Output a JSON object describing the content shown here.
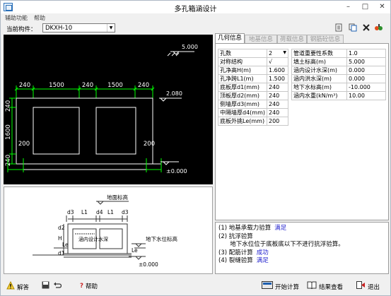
{
  "window": {
    "title": "多孔箱涵设计"
  },
  "menu": [
    "辅助功能",
    "帮助"
  ],
  "component": {
    "label": "当前构件：",
    "value": "DKXH-10"
  },
  "toolbar_icons": [
    "new-file-icon",
    "copy-icon",
    "delete-icon",
    "settings-icon"
  ],
  "tabs": [
    {
      "label": "几何信息",
      "active": true
    },
    {
      "label": "地基信息",
      "active": false
    },
    {
      "label": "荷载信息",
      "active": false
    },
    {
      "label": "钢筋砼信息",
      "active": false
    }
  ],
  "geometry_params": [
    {
      "name": "孔数",
      "value": "2",
      "dropdown": true
    },
    {
      "name": "对称结构",
      "value": "√"
    },
    {
      "name": "孔净高H(m)",
      "value": "1.600"
    },
    {
      "name": "孔净跨L1(m)",
      "value": "1.500"
    },
    {
      "name": "底板厚d1(mm)",
      "value": "240"
    },
    {
      "name": "顶板厚d2(mm)",
      "value": "240"
    },
    {
      "name": "侧墙厚d3(mm)",
      "value": "240"
    },
    {
      "name": "中隔墙厚d4(mm)",
      "value": "240"
    },
    {
      "name": "底板外挑Le(mm)",
      "value": "200"
    }
  ],
  "other_params": [
    {
      "name": "管道重要性系数",
      "value": "1.0"
    },
    {
      "name": "填土标高(m)",
      "value": "5.000"
    },
    {
      "name": "涵内设计水深(m)",
      "value": "0.000"
    },
    {
      "name": "涵内洪水深(m)",
      "value": "0.000"
    },
    {
      "name": "地下水标高(m)",
      "value": "-10.000"
    },
    {
      "name": "涵内水重(kN/m³)",
      "value": "10.00"
    }
  ],
  "drawing": {
    "fill_elev": "5.000",
    "top_elev": "2.080",
    "base_elev": "±0.000",
    "top_dims": [
      "240",
      "1500",
      "240",
      "1500",
      "240"
    ],
    "height_dims": [
      "240",
      "1600",
      "240"
    ],
    "bottom_dims": [
      "200",
      "200"
    ]
  },
  "schematic": {
    "ground_label": "地面标高",
    "water_label": "地下水位标高",
    "inner_water_label": "涵内设计水深",
    "zero_label": "±0.000",
    "dim_labels": [
      "d3",
      "L1",
      "d4",
      "L1",
      "d3"
    ],
    "side_labels": [
      "d2",
      "H",
      "d1"
    ],
    "le_labels": [
      "Le",
      "Le"
    ]
  },
  "results": [
    {
      "text": "(1) 地基承载力验算",
      "status": "满足"
    },
    {
      "text": "(2) 抗浮验算",
      "status": ""
    },
    {
      "text": "      地下水位位于底板底以下不进行抗浮验算。",
      "status": ""
    },
    {
      "text": "(3) 配筋计算",
      "status": "成功"
    },
    {
      "text": "(4) 裂缝验算",
      "status": "满足"
    }
  ],
  "buttons": {
    "answer": "解答",
    "help": "帮助",
    "start_calc": "开始计算",
    "view_results": "结果查看",
    "exit": "退出"
  },
  "colors": {
    "drawing_bg": "#000000",
    "dim_green": "#00ff00",
    "wall_white": "#ffffff",
    "status_blue": "#1a1acc"
  }
}
